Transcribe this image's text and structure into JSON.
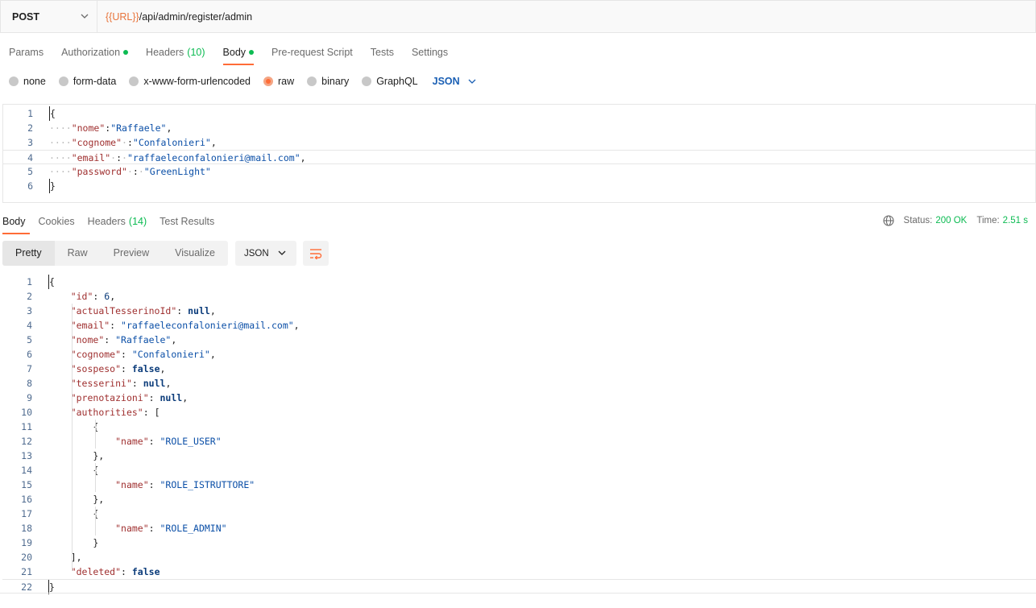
{
  "request": {
    "method": "POST",
    "url_variable": "{{URL}}",
    "url_path": "/api/admin/register/admin",
    "tabs": [
      {
        "label": "Params",
        "count": "",
        "dot": false,
        "active": false
      },
      {
        "label": "Authorization",
        "count": "",
        "dot": true,
        "active": false
      },
      {
        "label": "Headers",
        "count": "(10)",
        "dot": false,
        "active": false
      },
      {
        "label": "Body",
        "count": "",
        "dot": true,
        "active": true
      },
      {
        "label": "Pre-request Script",
        "count": "",
        "dot": false,
        "active": false
      },
      {
        "label": "Tests",
        "count": "",
        "dot": false,
        "active": false
      },
      {
        "label": "Settings",
        "count": "",
        "dot": false,
        "active": false
      }
    ],
    "body_types": [
      {
        "label": "none",
        "selected": false
      },
      {
        "label": "form-data",
        "selected": false
      },
      {
        "label": "x-www-form-urlencoded",
        "selected": false
      },
      {
        "label": "raw",
        "selected": true
      },
      {
        "label": "binary",
        "selected": false
      },
      {
        "label": "GraphQL",
        "selected": false
      }
    ],
    "language": "JSON",
    "code_lines": [
      [
        {
          "t": "{",
          "c": "pun"
        }
      ],
      [
        {
          "t": "····",
          "c": "ws"
        },
        {
          "t": "\"nome\"",
          "c": "key"
        },
        {
          "t": ":",
          "c": "pun"
        },
        {
          "t": "\"Raffaele\"",
          "c": "str"
        },
        {
          "t": ",",
          "c": "pun"
        }
      ],
      [
        {
          "t": "····",
          "c": "ws"
        },
        {
          "t": "\"cognome\"",
          "c": "key"
        },
        {
          "t": "·",
          "c": "ws"
        },
        {
          "t": ":",
          "c": "pun"
        },
        {
          "t": "\"Confalonieri\"",
          "c": "str"
        },
        {
          "t": ",",
          "c": "pun"
        }
      ],
      [
        {
          "t": "····",
          "c": "ws"
        },
        {
          "t": "\"email\"",
          "c": "key"
        },
        {
          "t": "·",
          "c": "ws"
        },
        {
          "t": ":",
          "c": "pun"
        },
        {
          "t": "·",
          "c": "ws"
        },
        {
          "t": "\"raffaeleconfalonieri@mail.com\"",
          "c": "str"
        },
        {
          "t": ",",
          "c": "pun"
        }
      ],
      [
        {
          "t": "····",
          "c": "ws"
        },
        {
          "t": "\"password\"",
          "c": "key"
        },
        {
          "t": "·",
          "c": "ws"
        },
        {
          "t": ":",
          "c": "pun"
        },
        {
          "t": "·",
          "c": "ws"
        },
        {
          "t": "\"GreenLight\"",
          "c": "str"
        }
      ],
      [
        {
          "t": "}",
          "c": "pun"
        }
      ]
    ]
  },
  "response": {
    "tabs": [
      {
        "label": "Body",
        "count": "",
        "active": true
      },
      {
        "label": "Cookies",
        "count": "",
        "active": false
      },
      {
        "label": "Headers",
        "count": "(14)",
        "active": false
      },
      {
        "label": "Test Results",
        "count": "",
        "active": false
      }
    ],
    "status_label": "Status:",
    "status_value": "200 OK",
    "time_label": "Time:",
    "time_value": "2.51 s",
    "view_modes": [
      {
        "label": "Pretty",
        "active": true
      },
      {
        "label": "Raw",
        "active": false
      },
      {
        "label": "Preview",
        "active": false
      },
      {
        "label": "Visualize",
        "active": false
      }
    ],
    "format": "JSON",
    "code_lines": [
      [
        {
          "t": "{",
          "c": "pun"
        }
      ],
      [
        {
          "t": "    ",
          "c": "pun"
        },
        {
          "t": "\"id\"",
          "c": "key"
        },
        {
          "t": ": ",
          "c": "pun"
        },
        {
          "t": "6",
          "c": "num"
        },
        {
          "t": ",",
          "c": "pun"
        }
      ],
      [
        {
          "t": "    ",
          "c": "pun"
        },
        {
          "t": "\"actualTesserinoId\"",
          "c": "key"
        },
        {
          "t": ": ",
          "c": "pun"
        },
        {
          "t": "null",
          "c": "kw"
        },
        {
          "t": ",",
          "c": "pun"
        }
      ],
      [
        {
          "t": "    ",
          "c": "pun"
        },
        {
          "t": "\"email\"",
          "c": "key"
        },
        {
          "t": ": ",
          "c": "pun"
        },
        {
          "t": "\"raffaeleconfalonieri@mail.com\"",
          "c": "str"
        },
        {
          "t": ",",
          "c": "pun"
        }
      ],
      [
        {
          "t": "    ",
          "c": "pun"
        },
        {
          "t": "\"nome\"",
          "c": "key"
        },
        {
          "t": ": ",
          "c": "pun"
        },
        {
          "t": "\"Raffaele\"",
          "c": "str"
        },
        {
          "t": ",",
          "c": "pun"
        }
      ],
      [
        {
          "t": "    ",
          "c": "pun"
        },
        {
          "t": "\"cognome\"",
          "c": "key"
        },
        {
          "t": ": ",
          "c": "pun"
        },
        {
          "t": "\"Confalonieri\"",
          "c": "str"
        },
        {
          "t": ",",
          "c": "pun"
        }
      ],
      [
        {
          "t": "    ",
          "c": "pun"
        },
        {
          "t": "\"sospeso\"",
          "c": "key"
        },
        {
          "t": ": ",
          "c": "pun"
        },
        {
          "t": "false",
          "c": "kw"
        },
        {
          "t": ",",
          "c": "pun"
        }
      ],
      [
        {
          "t": "    ",
          "c": "pun"
        },
        {
          "t": "\"tesserini\"",
          "c": "key"
        },
        {
          "t": ": ",
          "c": "pun"
        },
        {
          "t": "null",
          "c": "kw"
        },
        {
          "t": ",",
          "c": "pun"
        }
      ],
      [
        {
          "t": "    ",
          "c": "pun"
        },
        {
          "t": "\"prenotazioni\"",
          "c": "key"
        },
        {
          "t": ": ",
          "c": "pun"
        },
        {
          "t": "null",
          "c": "kw"
        },
        {
          "t": ",",
          "c": "pun"
        }
      ],
      [
        {
          "t": "    ",
          "c": "pun"
        },
        {
          "t": "\"authorities\"",
          "c": "key"
        },
        {
          "t": ": [",
          "c": "pun"
        }
      ],
      [
        {
          "t": "        {",
          "c": "pun"
        }
      ],
      [
        {
          "t": "            ",
          "c": "pun"
        },
        {
          "t": "\"name\"",
          "c": "key"
        },
        {
          "t": ": ",
          "c": "pun"
        },
        {
          "t": "\"ROLE_USER\"",
          "c": "str"
        }
      ],
      [
        {
          "t": "        },",
          "c": "pun"
        }
      ],
      [
        {
          "t": "        {",
          "c": "pun"
        }
      ],
      [
        {
          "t": "            ",
          "c": "pun"
        },
        {
          "t": "\"name\"",
          "c": "key"
        },
        {
          "t": ": ",
          "c": "pun"
        },
        {
          "t": "\"ROLE_ISTRUTTORE\"",
          "c": "str"
        }
      ],
      [
        {
          "t": "        },",
          "c": "pun"
        }
      ],
      [
        {
          "t": "        {",
          "c": "pun"
        }
      ],
      [
        {
          "t": "            ",
          "c": "pun"
        },
        {
          "t": "\"name\"",
          "c": "key"
        },
        {
          "t": ": ",
          "c": "pun"
        },
        {
          "t": "\"ROLE_ADMIN\"",
          "c": "str"
        }
      ],
      [
        {
          "t": "        }",
          "c": "pun"
        }
      ],
      [
        {
          "t": "    ],",
          "c": "pun"
        }
      ],
      [
        {
          "t": "    ",
          "c": "pun"
        },
        {
          "t": "\"deleted\"",
          "c": "key"
        },
        {
          "t": ": ",
          "c": "pun"
        },
        {
          "t": "false",
          "c": "kw"
        }
      ],
      [
        {
          "t": "}",
          "c": "pun"
        }
      ]
    ]
  },
  "colors": {
    "accent": "#ff6c37",
    "success": "#0cbb52",
    "key": "#9f2f2f",
    "string": "#0b4fa7"
  }
}
